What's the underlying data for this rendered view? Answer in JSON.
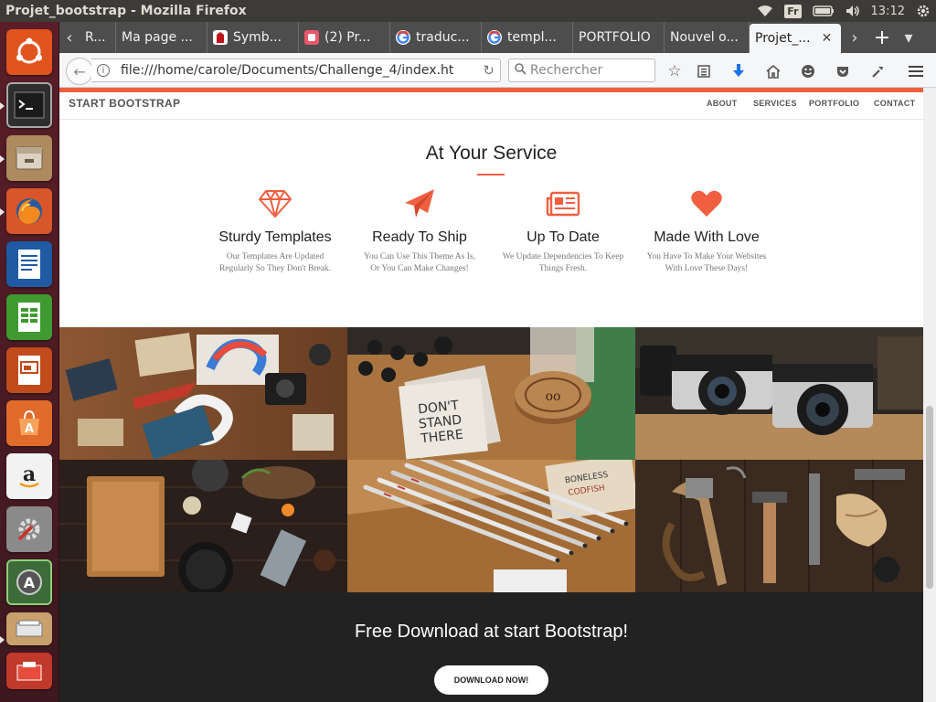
{
  "system": {
    "window_title": "Projet_bootstrap - Mozilla Firefox",
    "keyboard_layout": "Fr",
    "clock": "13:12"
  },
  "launcher": {
    "items": [
      {
        "name": "ubuntu-dash-icon"
      },
      {
        "name": "terminal-icon"
      },
      {
        "name": "files-icon"
      },
      {
        "name": "firefox-icon"
      },
      {
        "name": "writer-icon"
      },
      {
        "name": "calc-icon"
      },
      {
        "name": "impress-icon"
      },
      {
        "name": "software-center-icon"
      },
      {
        "name": "amazon-icon"
      },
      {
        "name": "system-settings-icon"
      },
      {
        "name": "software-updater-icon"
      },
      {
        "name": "scanner-icon"
      },
      {
        "name": "backup-icon"
      }
    ]
  },
  "browser": {
    "tabs": [
      {
        "label": "R...",
        "active": false
      },
      {
        "label": "Ma page ...",
        "active": false
      },
      {
        "label": "Symb...",
        "active": false
      },
      {
        "label": "(2) Pr...",
        "active": false
      },
      {
        "label": "traduc...",
        "active": false
      },
      {
        "label": "templ...",
        "active": false
      },
      {
        "label": "PORTFOLIO",
        "active": false
      },
      {
        "label": "Nouvel o...",
        "active": false
      },
      {
        "label": "Projet_...",
        "active": true
      }
    ],
    "url": "file:///home/carole/Documents/Challenge_4/index.ht",
    "search_placeholder": "Rechercher"
  },
  "site": {
    "brand": "START BOOTSTRAP",
    "nav": [
      "ABOUT",
      "SERVICES",
      "PORTFOLIO",
      "CONTACT"
    ],
    "services_heading": "At Your Service",
    "services": [
      {
        "icon": "diamond-icon",
        "title": "Sturdy Templates",
        "desc": "Our Templates Are Updated Regularly So They Don't Break."
      },
      {
        "icon": "paper-plane-icon",
        "title": "Ready To Ship",
        "desc": "You Can Use This Theme As Is, Or You Can Make Changes!"
      },
      {
        "icon": "newspaper-icon",
        "title": "Up To Date",
        "desc": "We Update Dependencies To Keep Things Fresh."
      },
      {
        "icon": "heart-icon",
        "title": "Made With Love",
        "desc": "You Have To Make Your Websites With Love These Days!"
      }
    ],
    "accent_color": "#f05f40",
    "portfolio": [
      {
        "name": "portfolio-photo-branding-mockup"
      },
      {
        "name": "portfolio-photo-dont-stand-there-coasters"
      },
      {
        "name": "portfolio-photo-vintage-cameras"
      },
      {
        "name": "portfolio-photo-kitchen-board"
      },
      {
        "name": "portfolio-photo-pencils"
      },
      {
        "name": "portfolio-photo-tools"
      }
    ],
    "cta_heading": "Free Download at start Bootstrap!",
    "cta_button": "DOWNLOAD NOW!"
  }
}
